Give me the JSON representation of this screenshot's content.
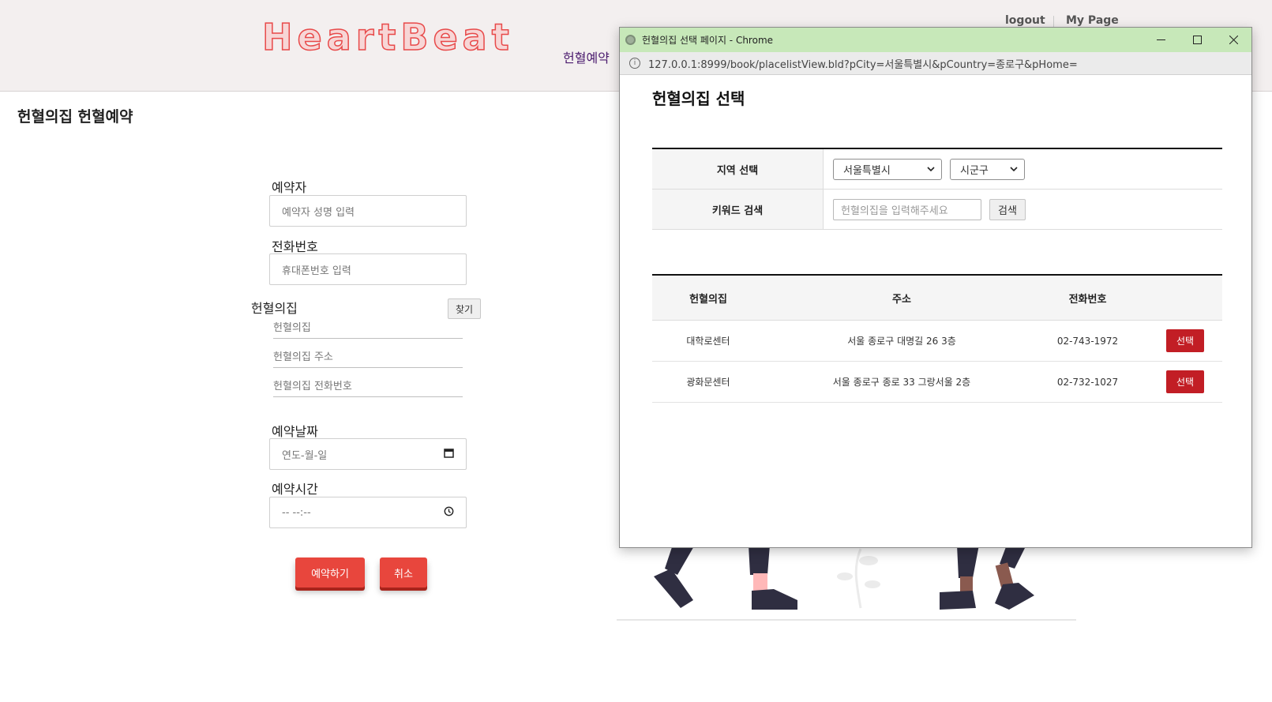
{
  "site": {
    "logo": "HeartBeat",
    "nav_reservation": "헌혈예약",
    "logout": "logout",
    "mypage": "My Page"
  },
  "page_title": "헌혈의집 헌혈예약",
  "form": {
    "booker_label": "예약자",
    "booker_placeholder": "예약자 성명 입력",
    "phone_label": "전화번호",
    "phone_placeholder": "휴대폰번호 입력",
    "place_label": "헌혈의집",
    "find_button": "찾기",
    "place_name_placeholder": "헌혈의집",
    "place_addr_placeholder": "헌혈의집 주소",
    "place_phone_placeholder": "헌혈의집 전화번호",
    "date_label": "예약날짜",
    "date_placeholder": "연도-월-일",
    "time_label": "예약시간",
    "time_placeholder": "--  --:--",
    "submit_button": "예약하기",
    "cancel_button": "취소"
  },
  "popup": {
    "window_title": "헌혈의집 선택 페이지 - Chrome",
    "url": "127.0.0.1:8999/book/placelistView.bld?pCity=서울특별시&pCountry=종로구&pHome=",
    "heading": "헌혈의집 선택",
    "region_label": "지역 선택",
    "city_selected": "서울특별시",
    "district_selected": "시군구",
    "keyword_label": "키워드 검색",
    "keyword_placeholder": "헌혈의집을 입력해주세요",
    "search_button": "검색",
    "columns": [
      "헌혈의집",
      "주소",
      "전화번호"
    ],
    "rows": [
      {
        "name": "대학로센터",
        "address": "서울 종로구 대명길 26 3층",
        "phone": "02-743-1972",
        "button": "선택"
      },
      {
        "name": "광화문센터",
        "address": "서울 종로구 종로 33 그랑서울 2층",
        "phone": "02-732-1027",
        "button": "선택"
      }
    ]
  },
  "colors": {
    "accent_red": "#e8463d",
    "select_red": "#c21e25",
    "titlebar_green": "#c7e8b9"
  }
}
